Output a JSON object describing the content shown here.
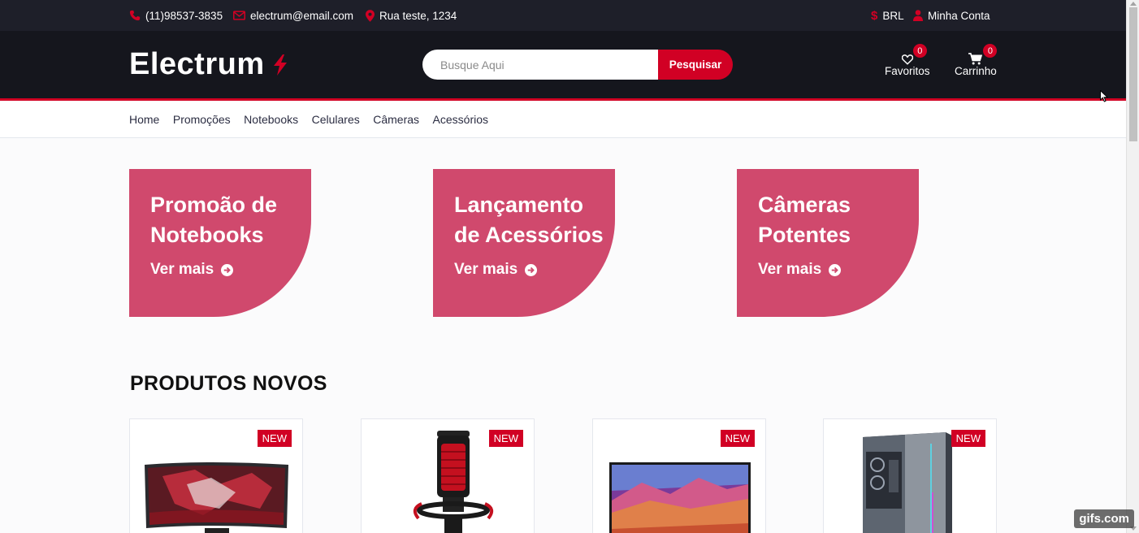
{
  "topbar": {
    "phone": "(11)98537-3835",
    "email": "electrum@email.com",
    "address": "Rua teste, 1234",
    "currency": "BRL",
    "account": "Minha Conta",
    "icons": [
      "phone-icon",
      "envelope-icon",
      "map-marker-icon",
      "dollar-icon",
      "user-icon"
    ]
  },
  "header": {
    "logo": "Electrum",
    "search_placeholder": "Busque Aqui",
    "search_button": "Pesquisar",
    "wishlist": {
      "label": "Favoritos",
      "count": "0"
    },
    "cart": {
      "label": "Carrinho",
      "count": "0"
    }
  },
  "nav": {
    "items": [
      "Home",
      "Promoções",
      "Notebooks",
      "Celulares",
      "Câmeras",
      "Acessórios"
    ]
  },
  "banners": [
    {
      "title_line1": "Promoão de",
      "title_line2": "Notebooks",
      "cta": "Ver mais"
    },
    {
      "title_line1": "Lançamento",
      "title_line2": "de Acessórios",
      "cta": "Ver mais"
    },
    {
      "title_line1": "Câmeras",
      "title_line2": "Potentes",
      "cta": "Ver mais"
    }
  ],
  "section": {
    "title": "PRODUTOS NOVOS"
  },
  "products": [
    {
      "badge": "NEW",
      "image": "monitor"
    },
    {
      "badge": "NEW",
      "image": "microphone"
    },
    {
      "badge": "NEW",
      "image": "tv"
    },
    {
      "badge": "NEW",
      "image": "pc-case"
    }
  ],
  "watermark": "gifs.com",
  "colors": {
    "accent": "#d10024",
    "banner": "#d0496d",
    "topbar": "#1e1f29",
    "header": "#15161d"
  }
}
